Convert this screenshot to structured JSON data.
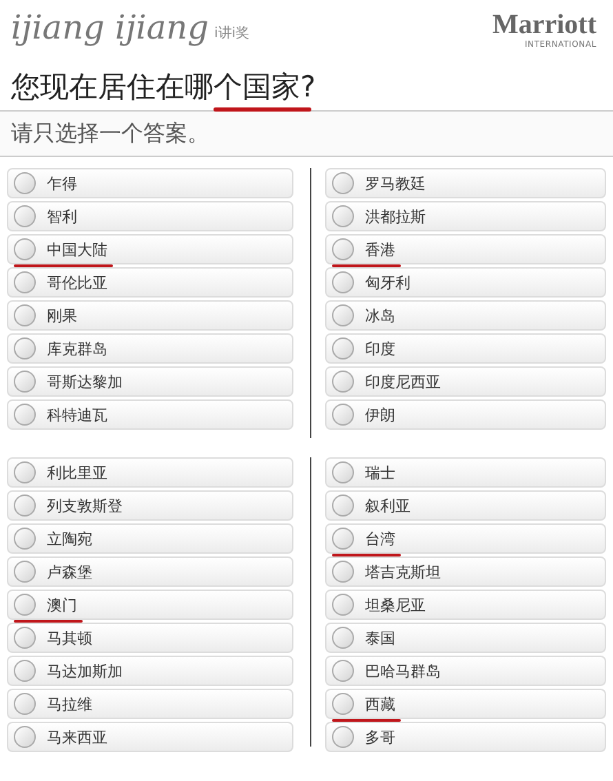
{
  "header": {
    "logo": "ijiang ijiang",
    "logo_sub": "i讲i奖",
    "brand": "Marriott",
    "brand_sub": "INTERNATIONAL"
  },
  "question": {
    "parts": [
      {
        "text": "您现在居住在哪",
        "underlined": false
      },
      {
        "text": "个国家",
        "underlined": true
      },
      {
        "text": "?",
        "underlined": false
      }
    ]
  },
  "instruction": "请只选择一个答案。",
  "panels": [
    {
      "options": [
        {
          "label": "乍得",
          "selected": false,
          "underlined": false
        },
        {
          "label": "智利",
          "selected": false,
          "underlined": false
        },
        {
          "label": "中国大陆",
          "selected": false,
          "underlined": true
        },
        {
          "label": "哥伦比亚",
          "selected": false,
          "underlined": false
        },
        {
          "label": "刚果",
          "selected": false,
          "underlined": false
        },
        {
          "label": "库克群岛",
          "selected": false,
          "underlined": false
        },
        {
          "label": "哥斯达黎加",
          "selected": false,
          "underlined": false
        },
        {
          "label": "科特迪瓦",
          "selected": false,
          "underlined": false
        }
      ]
    },
    {
      "options": [
        {
          "label": "罗马教廷",
          "selected": false,
          "underlined": false
        },
        {
          "label": "洪都拉斯",
          "selected": false,
          "underlined": false
        },
        {
          "label": "香港",
          "selected": false,
          "underlined": true
        },
        {
          "label": "匈牙利",
          "selected": false,
          "underlined": false
        },
        {
          "label": "冰岛",
          "selected": false,
          "underlined": false
        },
        {
          "label": "印度",
          "selected": false,
          "underlined": false
        },
        {
          "label": "印度尼西亚",
          "selected": false,
          "underlined": false
        },
        {
          "label": "伊朗",
          "selected": false,
          "underlined": false
        }
      ]
    },
    {
      "options": [
        {
          "label": "利比里亚",
          "selected": false,
          "underlined": false
        },
        {
          "label": "列支敦斯登",
          "selected": false,
          "underlined": false
        },
        {
          "label": "立陶宛",
          "selected": false,
          "underlined": false
        },
        {
          "label": "卢森堡",
          "selected": false,
          "underlined": false
        },
        {
          "label": "澳门",
          "selected": false,
          "underlined": true
        },
        {
          "label": "马其顿",
          "selected": false,
          "underlined": false
        },
        {
          "label": "马达加斯加",
          "selected": false,
          "underlined": false
        },
        {
          "label": "马拉维",
          "selected": false,
          "underlined": false
        },
        {
          "label": "马来西亚",
          "selected": false,
          "underlined": false
        }
      ]
    },
    {
      "options": [
        {
          "label": "瑞士",
          "selected": false,
          "underlined": false
        },
        {
          "label": "叙利亚",
          "selected": false,
          "underlined": false
        },
        {
          "label": "台湾",
          "selected": false,
          "underlined": true
        },
        {
          "label": "塔吉克斯坦",
          "selected": false,
          "underlined": false
        },
        {
          "label": "坦桑尼亚",
          "selected": false,
          "underlined": false
        },
        {
          "label": "泰国",
          "selected": false,
          "underlined": false
        },
        {
          "label": "巴哈马群岛",
          "selected": false,
          "underlined": false
        },
        {
          "label": "西藏",
          "selected": false,
          "underlined": true
        },
        {
          "label": "多哥",
          "selected": false,
          "underlined": false
        }
      ]
    }
  ]
}
